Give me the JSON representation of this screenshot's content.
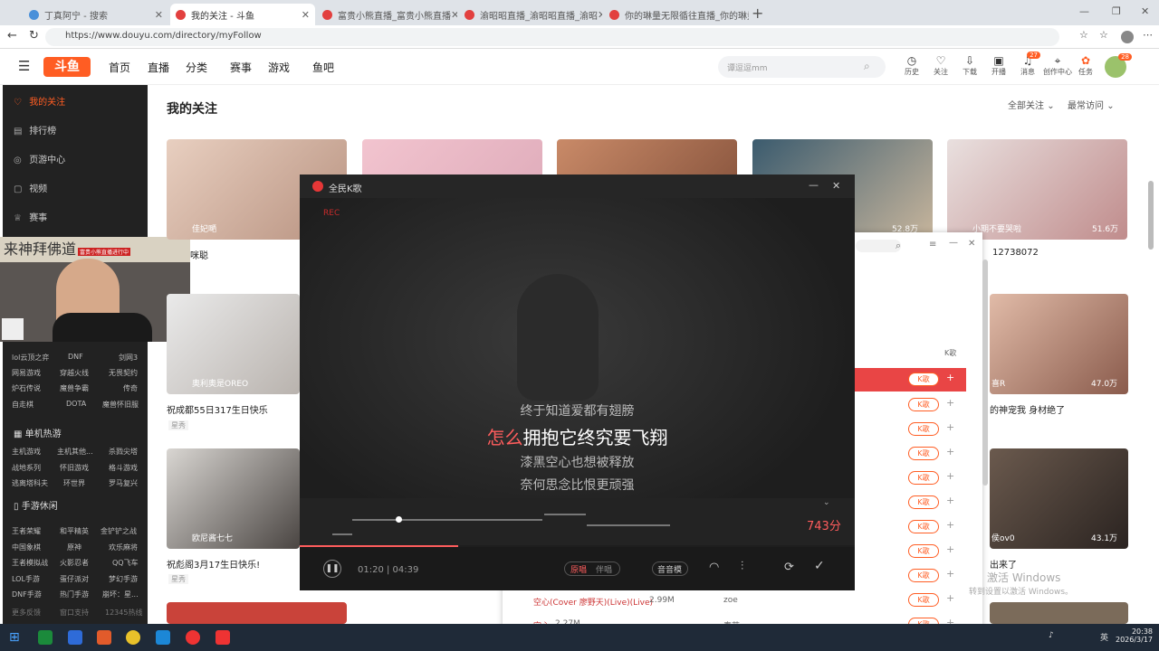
{
  "browser": {
    "tabs": [
      {
        "label": "丁真阿宁 - 搜索"
      },
      {
        "label": "我的关注 - 斗鱼"
      },
      {
        "label": "富贵小熊直播_富贵小熊直播"
      },
      {
        "label": "渝昭昭直播_渝昭昭直播_渝昭"
      },
      {
        "label": "你的琳量无限循往直播_你的琳量"
      }
    ],
    "new_tab": "+",
    "url": "https://www.douyu.com/directory/myFollow"
  },
  "header": {
    "logo": "斗鱼",
    "nav": [
      "首页",
      "直播",
      "分类",
      "赛事",
      "游戏",
      "鱼吧"
    ],
    "search_placeholder": "谭逗逗mm",
    "icons": [
      {
        "label": "历史",
        "icon": "clock-icon"
      },
      {
        "label": "关注",
        "icon": "heart-icon"
      },
      {
        "label": "下载",
        "icon": "download-icon"
      },
      {
        "label": "开播",
        "icon": "broadcast-icon"
      },
      {
        "label": "消息",
        "icon": "bell-icon",
        "badge": "27"
      },
      {
        "label": "创作中心",
        "icon": "pin-icon"
      },
      {
        "label": "任务",
        "icon": "gift-icon"
      }
    ],
    "avatar_badge": "28"
  },
  "sidebar": {
    "items": [
      {
        "label": "我的关注",
        "active": true
      },
      {
        "label": "排行榜"
      },
      {
        "label": "页游中心"
      },
      {
        "label": "视频"
      },
      {
        "label": "赛事"
      }
    ],
    "games1": [
      "lol云顶之弈",
      "DNF",
      "剑网3",
      "网易游戏",
      "穿越火线",
      "无畏契约",
      "炉石传说",
      "魔兽争霸",
      "传奇",
      "自走棋",
      "DOTA",
      "魔兽怀旧服"
    ],
    "group_single": "单机热游",
    "games2": [
      "主机游戏",
      "主机其他...",
      "杀戮尖塔",
      "战地系列",
      "怀旧游戏",
      "格斗游戏",
      "逃离塔科夫",
      "环世界",
      "罗马复兴"
    ],
    "group_mobile": "手游休闲",
    "games3": [
      "王者荣耀",
      "和平精英",
      "金铲铲之战",
      "中国象棋",
      "原神",
      "欢乐麻将",
      "王者模拟战",
      "火影忍者",
      "QQ飞车",
      "LOL手游",
      "蛋仔派对",
      "梦幻手游",
      "DNF手游",
      "热门手游",
      "崩坏：星..."
    ],
    "bottom": [
      "更多反馈",
      "窗口支持",
      "12345热线"
    ]
  },
  "cam": {
    "banner": "来神拜佛道",
    "note": "富贵小熊直播进行中"
  },
  "main": {
    "title": "我的关注",
    "filter_all": "全部关注",
    "filter_recent": "最常访问",
    "cards": [
      {
        "name": "佳妃嗮",
        "caption": "咪聪"
      },
      {
        "name": "",
        "caption": ""
      },
      {
        "name": "",
        "caption": ""
      },
      {
        "name": "",
        "count": "52.8万",
        "caption": ""
      },
      {
        "name": "小期不要哭啦",
        "count": "51.6万",
        "caption": "12738072"
      },
      {
        "name": "奥利奥是OREO",
        "caption": "祝成都55日317生日快乐",
        "tag": "星秀"
      },
      {
        "name": "喜R",
        "count": "47.0万",
        "caption": "的神宠我 身材绝了"
      },
      {
        "name": "欧尼酱七七",
        "caption": "祝彪阁3月17生日快乐!",
        "tag": "星秀"
      },
      {
        "name": "侯ov0",
        "count": "43.1万",
        "caption": "出来了"
      }
    ]
  },
  "bg_popup": {
    "header_k": "K歌",
    "k_label": "K歌",
    "songs": [
      {
        "title": "空心(Cover 廖野天)(Live)(Live)",
        "size": "2.99M",
        "singer": "zoe"
      },
      {
        "title": "空心",
        "size": "2.27M",
        "singer": "泰芭"
      }
    ]
  },
  "karaoke": {
    "title": "全民K歌",
    "rec": "REC",
    "lyrics": [
      "终于知道爱都有翅膀",
      "怎么",
      "拥抱它终究要飞翔",
      "漆黑空心也想被释放",
      "奈何思念比恨更顽强"
    ],
    "score": "743分",
    "time": "01:20 | 04:39",
    "mode_a": "原唱",
    "mode_b": "伴唱",
    "sound": "音音模",
    "progress_fraction": 0.286
  },
  "windows_activate": {
    "title": "激活 Windows",
    "sub": "转到设置以激活 Windows。"
  },
  "taskbar": {
    "clock_time": "20:38",
    "clock_date": "2026/3/17",
    "ime": "英"
  },
  "colors": {
    "accent": "#ff5d23",
    "sidebar": "#222222",
    "karaoke_red": "#ff5d5d"
  }
}
